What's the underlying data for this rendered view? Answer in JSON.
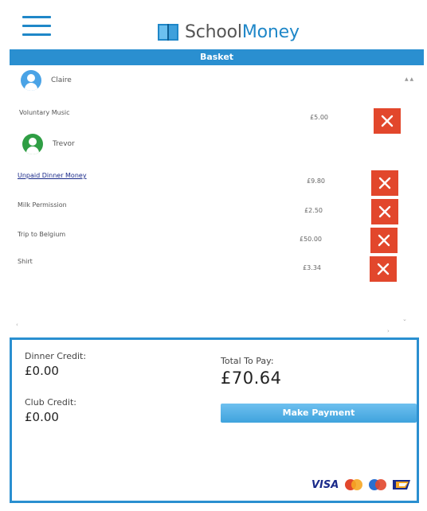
{
  "app": {
    "logo_part1": "School",
    "logo_part2": "Money"
  },
  "basket": {
    "title": "Basket",
    "people": [
      {
        "name": "Claire",
        "items": [
          {
            "name": "Voluntary Music",
            "price": "£5.00"
          }
        ]
      },
      {
        "name": "Trevor",
        "items": [
          {
            "name": "Unpaid Dinner Money",
            "price": "£9.80"
          },
          {
            "name": "Milk Permission",
            "price": "£2.50"
          },
          {
            "name": "Trip to Belgium",
            "price": "£50.00"
          },
          {
            "name": "Shirt",
            "price": "£3.34"
          }
        ]
      }
    ]
  },
  "summary": {
    "dinner_credit_label": "Dinner Credit:",
    "dinner_credit_value": "£0.00",
    "club_credit_label": "Club Credit:",
    "club_credit_value": "£0.00",
    "total_label": "Total To Pay:",
    "total_value": "£70.64",
    "pay_button": "Make Payment",
    "visa_label": "VISA"
  },
  "colors": {
    "accent": "#2a8fd0",
    "delete": "#e2472c",
    "claire_avatar": "#4aa3e6",
    "trevor_avatar": "#2f9e44"
  }
}
